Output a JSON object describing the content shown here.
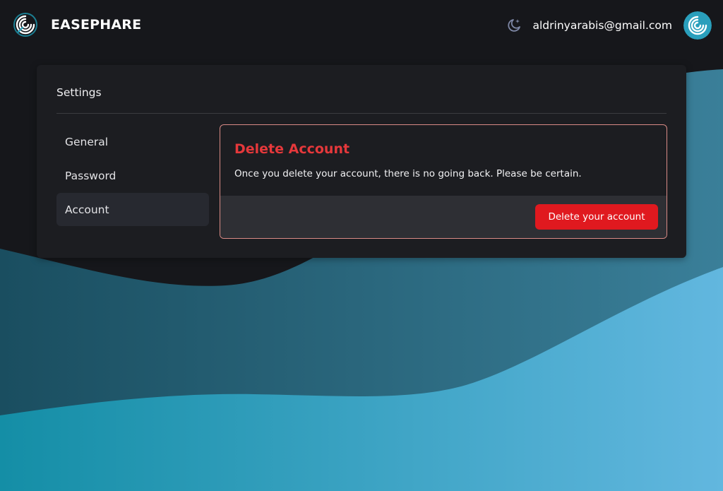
{
  "header": {
    "brand_name": "EASEPHARE",
    "user_email": "aldrinyarabis@gmail.com",
    "icons": {
      "logo": "spiral-logo-icon",
      "theme": "moon-star-icon",
      "avatar": "spiral-avatar-icon"
    }
  },
  "settings": {
    "title": "Settings",
    "nav": [
      {
        "label": "General",
        "active": false
      },
      {
        "label": "Password",
        "active": false
      },
      {
        "label": "Account",
        "active": true
      }
    ],
    "danger_zone": {
      "title": "Delete Account",
      "description": "Once you delete your account, there is no going back. Please be certain.",
      "button_label": "Delete your account"
    }
  },
  "colors": {
    "background": "#16171b",
    "card": "#1c1d21",
    "danger_title": "#e5383b",
    "danger_button": "#e0191f",
    "danger_border": "#d98b86",
    "wave_teal": "#1a93ae",
    "wave_light": "#5fb8de"
  }
}
